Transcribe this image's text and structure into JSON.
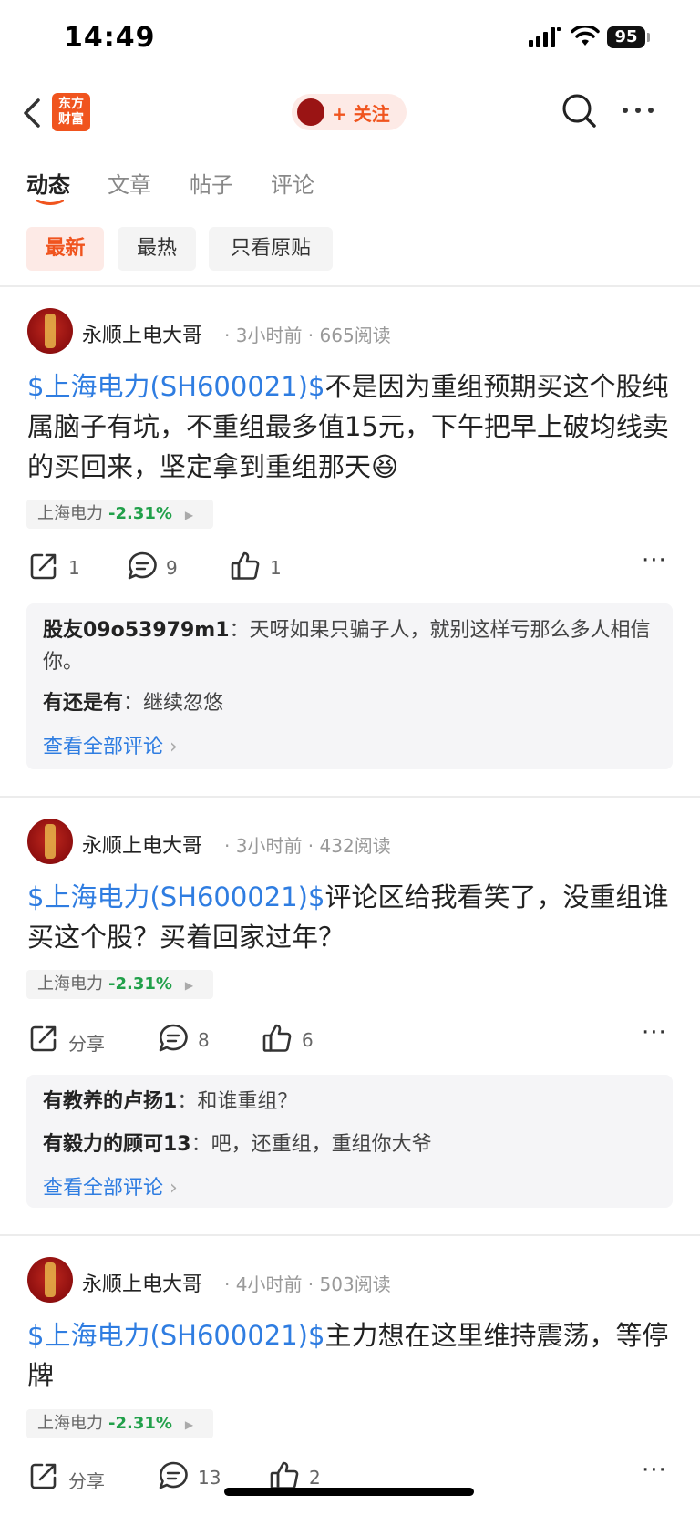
{
  "status_bar": {
    "time": "14:49",
    "battery": "95"
  },
  "header": {
    "logo_line1": "东方",
    "logo_line2": "财富",
    "follow_label": "+ 关注"
  },
  "tabs": [
    {
      "label": "动态",
      "active": true
    },
    {
      "label": "文章",
      "active": false
    },
    {
      "label": "帖子",
      "active": false
    },
    {
      "label": "评论",
      "active": false
    }
  ],
  "filters": [
    {
      "label": "最新",
      "active": true
    },
    {
      "label": "最热",
      "active": false
    },
    {
      "label": "只看原贴",
      "active": false
    }
  ],
  "posts": [
    {
      "author": "永顺上电大哥",
      "time": "3小时前",
      "reads": "665阅读",
      "stock_link": "$上海电力(SH600021)$",
      "text": "不是因为重组预期买这个股纯属脑子有坑，不重组最多值15元，下午把早上破均线卖的买回来，坚定拿到重组那天😆",
      "tag_name": "上海电力",
      "tag_change": "-2.31%",
      "share": "1",
      "comments": "9",
      "likes": "1",
      "comment_preview": [
        {
          "user": "股友09o53979m1",
          "text": "天呀如果只骗子人，就别这样亏那么多人相信你。"
        },
        {
          "user": "有还是有",
          "text": "继续忽悠"
        }
      ],
      "view_all": "查看全部评论"
    },
    {
      "author": "永顺上电大哥",
      "time": "3小时前",
      "reads": "432阅读",
      "stock_link": "$上海电力(SH600021)$",
      "text": "评论区给我看笑了，没重组谁买这个股？买着回家过年？",
      "tag_name": "上海电力",
      "tag_change": "-2.31%",
      "share": "分享",
      "comments": "8",
      "likes": "6",
      "comment_preview": [
        {
          "user": "有教养的卢扬1",
          "text": "和谁重组？"
        },
        {
          "user": "有毅力的顾可13",
          "text": "吧，还重组，重组你大爷"
        }
      ],
      "view_all": "查看全部评论"
    },
    {
      "author": "永顺上电大哥",
      "time": "4小时前",
      "reads": "503阅读",
      "stock_link": "$上海电力(SH600021)$",
      "text": "主力想在这里维持震荡，等停牌",
      "tag_name": "上海电力",
      "tag_change": "-2.31%",
      "share": "分享",
      "comments": "13",
      "likes": "2"
    }
  ],
  "colors": {
    "brand": "#f0541e",
    "link": "#2f7de1",
    "down": "#21a04a"
  },
  "icons": [
    "back-icon",
    "search-icon",
    "more-icon",
    "share-icon",
    "comment-icon",
    "like-icon"
  ]
}
